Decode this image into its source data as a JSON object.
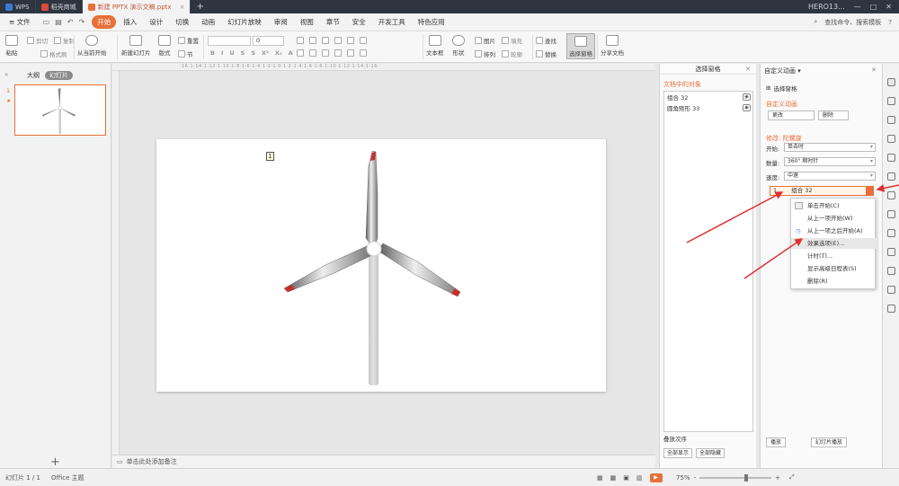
{
  "titlebar": {
    "tabs": [
      {
        "label": "WPS",
        "color": "#3a7bd5"
      },
      {
        "label": "稻壳商城",
        "color": "#d94c3a"
      },
      {
        "label": "新建 PPTX 演示文稿.pptx",
        "color": "#e8703a"
      }
    ],
    "add_tab": "+",
    "user": "HERO13...",
    "win_min": "—",
    "win_max": "□",
    "win_close": "✕"
  },
  "menubar": {
    "file": "≡ 文件",
    "items": [
      "开始",
      "插入",
      "设计",
      "切换",
      "动画",
      "幻灯片放映",
      "审阅",
      "视图",
      "章节",
      "安全",
      "开发工具",
      "特色应用"
    ],
    "active_index": 0,
    "search": "查找命令、搜索模板",
    "help": "?"
  },
  "ribbon": {
    "paste": "粘贴",
    "cut": "剪切",
    "copy": "复制",
    "format_painter": "格式刷",
    "from_current": "从当前开始",
    "new_slide": "新建幻灯片",
    "layout": "版式",
    "reset": "重置",
    "section": "节",
    "font_size": "0",
    "textbox": "文本框",
    "shape": "形状",
    "arrange": "排列",
    "picture": "图片",
    "fill": "填充",
    "outline": "轮廓",
    "find": "查找",
    "replace": "替换",
    "selection_pane": "选择窗格",
    "share": "分享文档"
  },
  "leftpanel": {
    "tab_outline": "大纲",
    "tab_slides": "幻灯片",
    "slide_number": "1",
    "add": "+"
  },
  "slide": {
    "anim_tag": "1"
  },
  "notes": {
    "placeholder": "单击此处添加备注"
  },
  "selection_pane": {
    "title": "选择窗格",
    "close": "✕",
    "section": "文档中的对象",
    "objects": [
      "组合 32",
      "圆角矩形 33"
    ],
    "order_label": "叠放次序",
    "show_all": "全部显示",
    "hide_all": "全部隐藏"
  },
  "anim_pane": {
    "title": "自定义动画 ▾",
    "close": "✕",
    "select_pane_link": "选择窗格",
    "custom_anim": "自定义动画",
    "change": "更改",
    "delete": "删除",
    "modify": "修改: 陀螺旋",
    "start_label": "开始:",
    "start_value": "单击时",
    "amount_label": "数量:",
    "amount_value": "360° 顺时针",
    "speed_label": "速度:",
    "speed_value": "中速",
    "item_index": "1",
    "item_name": "组合 32",
    "play": "播放",
    "slideshow": "幻灯片播放"
  },
  "context_menu": {
    "items": [
      "单击开始(C)",
      "从上一项开始(W)",
      "从上一项之后开始(A)",
      "效果选项(E)...",
      "计时(T)...",
      "显示高级日程表(S)",
      "删除(R)"
    ],
    "highlight_index": 3
  },
  "statusbar": {
    "slide_info": "幻灯片 1 / 1",
    "theme": "Office 主题",
    "zoom": "75%",
    "zoom_minus": "-",
    "zoom_plus": "+"
  },
  "colors": {
    "accent": "#e8703a",
    "annotation": "#e03030"
  }
}
